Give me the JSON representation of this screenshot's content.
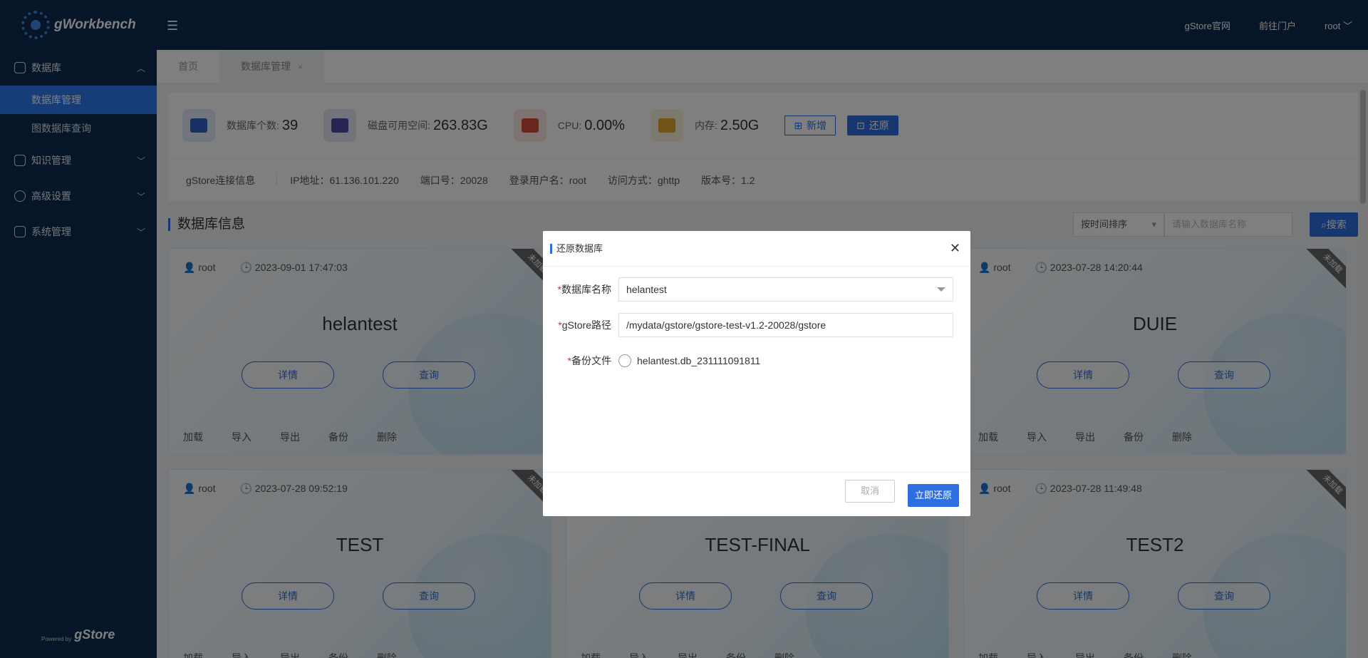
{
  "app": {
    "logo_text": "gWorkbench",
    "powered_by": "Powered by",
    "powered_brand": "gStore"
  },
  "sidebar": {
    "groups": [
      {
        "label": "数据库",
        "items": [
          {
            "label": "数据库管理"
          },
          {
            "label": "图数据库查询"
          }
        ]
      },
      {
        "label": "知识管理"
      },
      {
        "label": "高级设置"
      },
      {
        "label": "系统管理"
      }
    ]
  },
  "topbar": {
    "links": [
      "gStore官网",
      "前往门户",
      "root"
    ]
  },
  "tabs": [
    {
      "label": "首页"
    },
    {
      "label": "数据库管理",
      "close": "×"
    }
  ],
  "stats": [
    {
      "label": "数据库个数:",
      "value": "39",
      "icon": "monitor-chart-icon",
      "color": "#2f63c8"
    },
    {
      "label": "磁盘可用空间:",
      "value": "263.83G",
      "icon": "disk-icon",
      "color": "#4a4aa8"
    },
    {
      "label": "CPU:",
      "value": "0.00%",
      "icon": "cpu-icon",
      "color": "#d54b3a"
    },
    {
      "label": "内存:",
      "value": "2.50G",
      "icon": "memory-icon",
      "color": "#e0a92a"
    }
  ],
  "actions": {
    "add": "新增",
    "restore": "还原"
  },
  "conn": {
    "title": "gStore连接信息",
    "items": [
      "IP地址：61.136.101.220",
      "端口号：20028",
      "登录用户名：root",
      "访问方式：ghttp",
      "版本号：1.2"
    ]
  },
  "section": {
    "title": "数据库信息",
    "sort": "按时间排序",
    "search_placeholder": "请输入数据库名称",
    "search_btn": "搜索"
  },
  "cards": [
    {
      "user": "root",
      "time": "2023-09-01 17:47:03",
      "name": "helantest",
      "ribbon": "未加载"
    },
    {
      "user": "root",
      "time": "2023-07-28 14:20:44",
      "name": "DUIE",
      "ribbon": "未加载"
    },
    {
      "user": "root",
      "time": "2023-07-28 09:52:19",
      "name": "TEST",
      "ribbon": "未加载"
    },
    {
      "user": "root",
      "time": "",
      "name": "TEST-FINAL",
      "ribbon": ""
    },
    {
      "user": "root",
      "time": "2023-07-28 11:49:48",
      "name": "TEST2",
      "ribbon": "未加载"
    }
  ],
  "card_buttons": {
    "detail": "详情",
    "query": "查询"
  },
  "card_actions": [
    "加载",
    "导入",
    "导出",
    "备份",
    "删除"
  ],
  "modal": {
    "title": "还原数据库",
    "fields": [
      {
        "label": "数据库名称",
        "value": "helantest"
      },
      {
        "label": "gStore路径",
        "value": "/mydata/gstore/gstore-test-v1.2-20028/gstore"
      },
      {
        "label": "备份文件",
        "value": "helantest.db_231111091811"
      }
    ],
    "cancel": "取消",
    "confirm": "立即还原"
  }
}
